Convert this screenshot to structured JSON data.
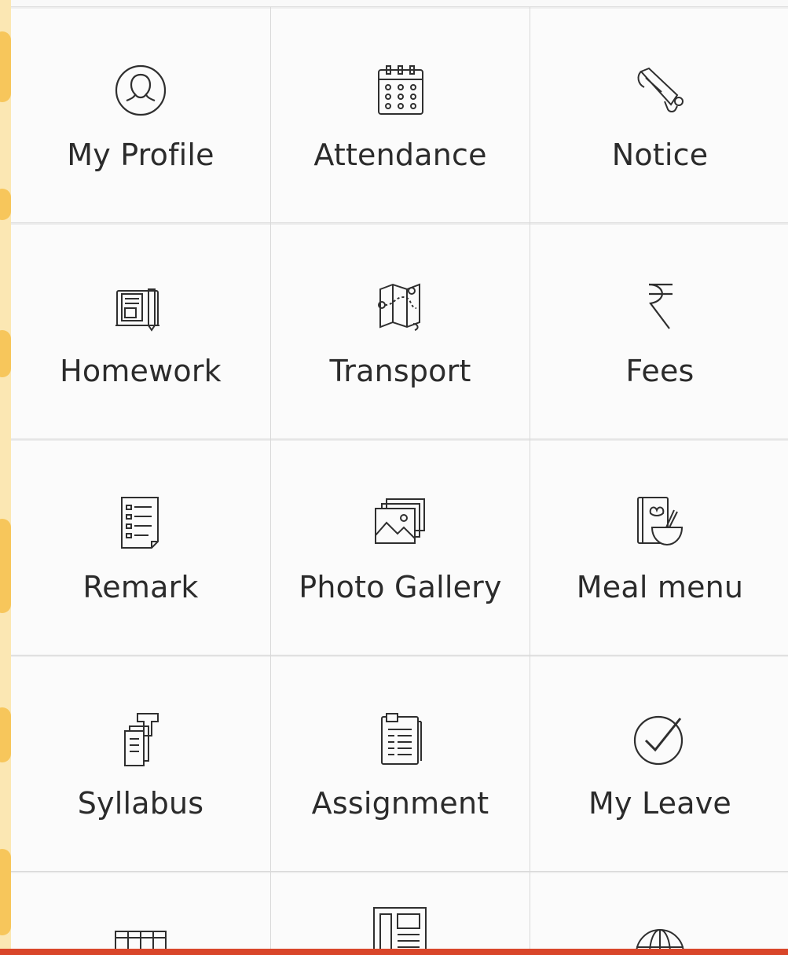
{
  "menu": {
    "tiles": [
      {
        "label": "My Profile",
        "icon": "profile-icon"
      },
      {
        "label": "Attendance",
        "icon": "calendar-icon"
      },
      {
        "label": "Notice",
        "icon": "megaphone-icon"
      },
      {
        "label": "Homework",
        "icon": "homework-book-icon"
      },
      {
        "label": "Transport",
        "icon": "route-map-icon"
      },
      {
        "label": "Fees",
        "icon": "rupee-icon"
      },
      {
        "label": "Remark",
        "icon": "checklist-icon"
      },
      {
        "label": "Photo Gallery",
        "icon": "photo-gallery-icon"
      },
      {
        "label": "Meal menu",
        "icon": "meal-bowl-icon"
      },
      {
        "label": "Syllabus",
        "icon": "syllabus-icon"
      },
      {
        "label": "Assignment",
        "icon": "assignment-icon"
      },
      {
        "label": "My Leave",
        "icon": "checkmark-circle-icon"
      }
    ],
    "partial_tiles": [
      {
        "icon": "timetable-icon"
      },
      {
        "icon": "newspaper-icon"
      },
      {
        "icon": "globe-icon"
      }
    ]
  },
  "colors": {
    "icon_stroke": "#2f2f2f",
    "text": "#2b2b2b",
    "bottom_bar": "#d9462a",
    "left_strip": "#f7c65b"
  }
}
